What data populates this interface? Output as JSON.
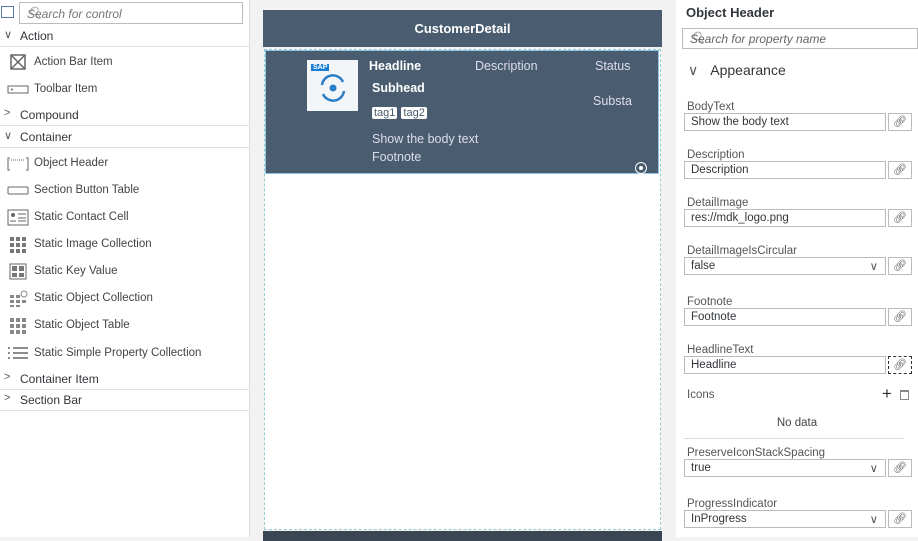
{
  "left": {
    "search_placeholder": "Search for control",
    "categories": [
      {
        "label": "Action",
        "expanded": true
      },
      {
        "label": "Compound",
        "expanded": false
      },
      {
        "label": "Container",
        "expanded": true
      },
      {
        "label": "Container Item",
        "expanded": false
      },
      {
        "label": "Section Bar",
        "expanded": false
      }
    ],
    "action_items": [
      "Action Bar Item",
      "Toolbar Item"
    ],
    "container_items": [
      "Object Header",
      "Section Button Table",
      "Static Contact Cell",
      "Static Image Collection",
      "Static Key Value",
      "Static Object Collection",
      "Static Object Table",
      "Static Simple Property Collection"
    ]
  },
  "center": {
    "title": "CustomerDetail",
    "object_header": {
      "headline": "Headline",
      "description": "Description",
      "status": "Status",
      "subhead": "Subhead",
      "substatus": "Substa",
      "tags": [
        "tag1",
        "tag2"
      ],
      "body": "Show the body text",
      "footnote": "Footnote",
      "logo_text": "SAP"
    }
  },
  "right": {
    "title": "Object Header",
    "search_placeholder": "Search for property name",
    "section": "Appearance",
    "props": [
      {
        "label": "BodyText",
        "value": "Show the body text",
        "type": "text"
      },
      {
        "label": "Description",
        "value": "Description",
        "type": "text"
      },
      {
        "label": "DetailImage",
        "value": "res://mdk_logo.png",
        "type": "text"
      },
      {
        "label": "DetailImageIsCircular",
        "value": "false",
        "type": "select"
      },
      {
        "label": "Footnote",
        "value": "Footnote",
        "type": "text"
      },
      {
        "label": "HeadlineText",
        "value": "Headline",
        "type": "text"
      }
    ],
    "icons_label": "Icons",
    "icons_empty": "No data",
    "props2": [
      {
        "label": "PreserveIconStackSpacing",
        "value": "true",
        "type": "select"
      },
      {
        "label": "ProgressIndicator",
        "value": "InProgress",
        "type": "select"
      }
    ]
  }
}
